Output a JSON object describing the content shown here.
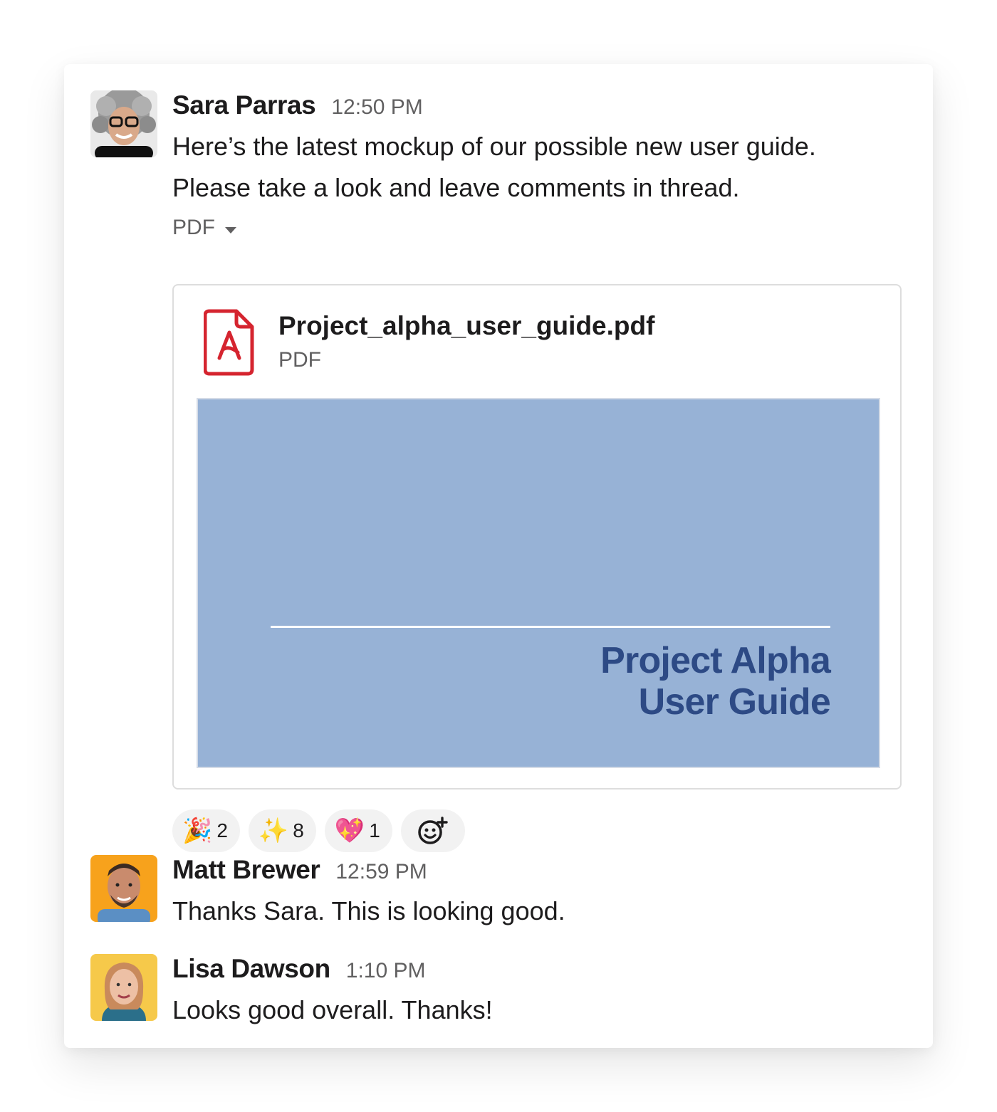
{
  "messages": [
    {
      "author": "Sara Parras",
      "time": "12:50 PM",
      "text_lines": [
        "Here’s the latest mockup of our possible new user guide.",
        "Please take a look and leave comments in thread."
      ],
      "file_type_toggle": "PDF",
      "attachment": {
        "file_name": "Project_alpha_user_guide.pdf",
        "file_kind": "PDF",
        "preview_title_lines": [
          "Project Alpha",
          "User Guide"
        ],
        "icon": "pdf-file-icon"
      },
      "reactions": [
        {
          "emoji": "🎉",
          "icon": "party-popper-emoji",
          "count": "2"
        },
        {
          "emoji": "✨",
          "icon": "sparkles-emoji",
          "count": "8"
        },
        {
          "emoji": "💖",
          "icon": "sparkling-heart-emoji",
          "count": "1"
        }
      ],
      "add_reaction_icon": "add-reaction-icon"
    },
    {
      "author": "Matt Brewer",
      "time": "12:59 PM",
      "text": "Thanks Sara. This is looking good."
    },
    {
      "author": "Lisa Dawson",
      "time": "1:10 PM",
      "text": "Looks good overall. Thanks!"
    }
  ],
  "colors": {
    "pdf_icon": "#d5242f",
    "preview_background": "#97b2d6",
    "preview_title": "#2d4a85",
    "reaction_pill": "#f2f2f2",
    "avatar_matt_background": "#f7a21c",
    "avatar_lisa_background": "#f6c94a"
  }
}
